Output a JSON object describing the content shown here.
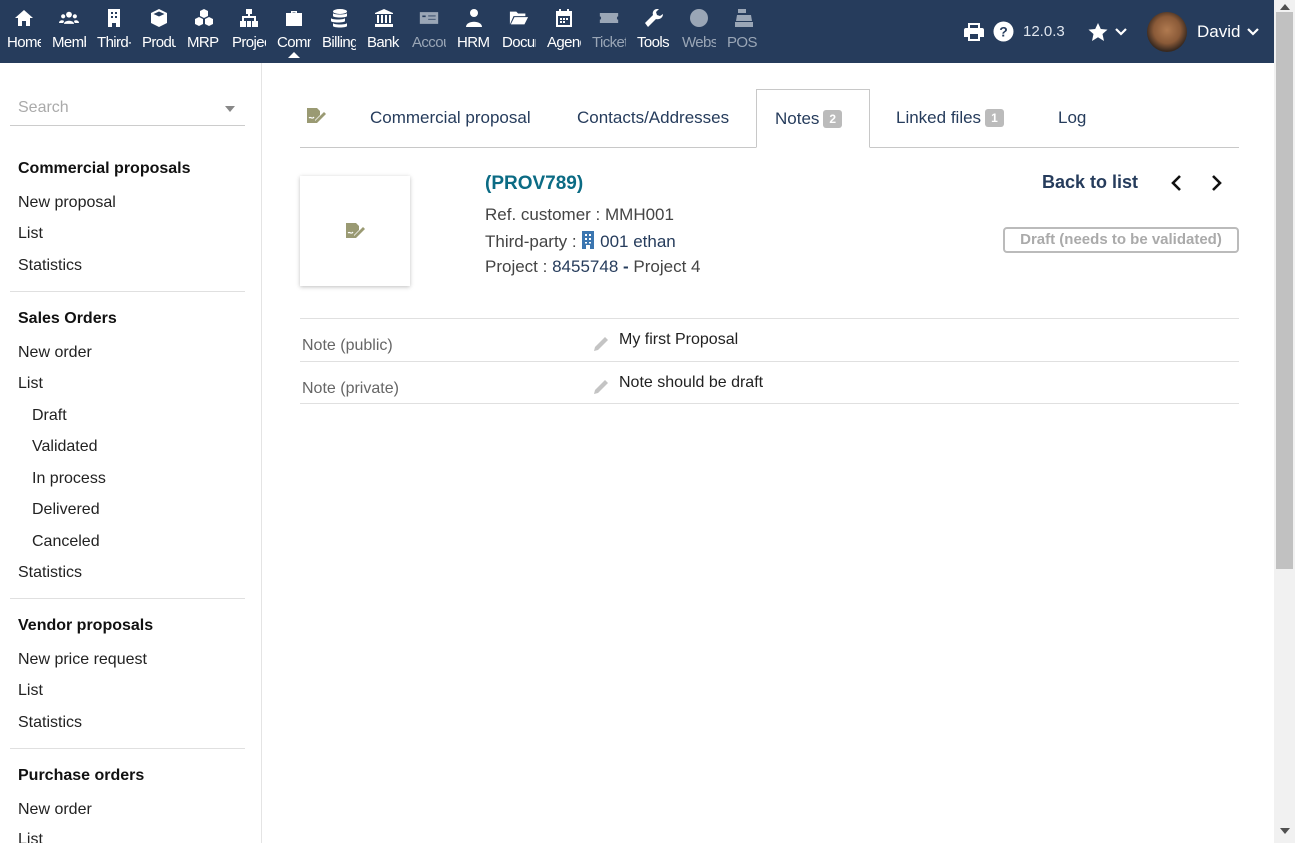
{
  "top_menu": [
    {
      "label": "Home",
      "icon": "home-icon"
    },
    {
      "label": "Members",
      "icon": "members-icon"
    },
    {
      "label": "Third-parties",
      "icon": "building-icon"
    },
    {
      "label": "Products",
      "icon": "cube-icon"
    },
    {
      "label": "MRP",
      "icon": "cubes-icon"
    },
    {
      "label": "Projects",
      "icon": "sitemap-icon"
    },
    {
      "label": "Commercial",
      "icon": "suitcase-icon"
    },
    {
      "label": "Billing",
      "icon": "coins-icon"
    },
    {
      "label": "Bank",
      "icon": "bank-icon"
    },
    {
      "label": "Accounting",
      "icon": "money-check-icon"
    },
    {
      "label": "HRM",
      "icon": "user-tie-icon"
    },
    {
      "label": "Documents",
      "icon": "folder-open-icon"
    },
    {
      "label": "Agenda",
      "icon": "calendar-icon"
    },
    {
      "label": "Tickets",
      "icon": "ticket-icon"
    },
    {
      "label": "Tools",
      "icon": "wrench-icon"
    },
    {
      "label": "Website",
      "icon": "globe-icon"
    },
    {
      "label": "POS",
      "icon": "cash-register-icon"
    }
  ],
  "top_right": {
    "version": "12.0.3",
    "user_name": "David"
  },
  "sidebar": {
    "search_placeholder": "Search",
    "sections": [
      {
        "title": "Commercial proposals",
        "items": [
          "New proposal",
          "List",
          "Statistics"
        ]
      },
      {
        "title": "Sales Orders",
        "items": [
          "New order",
          "List",
          "Draft",
          "Validated",
          "In process",
          "Delivered",
          "Canceled",
          "Statistics"
        ]
      },
      {
        "title": "Vendor proposals",
        "items": [
          "New price request",
          "List",
          "Statistics"
        ]
      },
      {
        "title": "Purchase orders",
        "items": [
          "New order",
          "List"
        ]
      }
    ]
  },
  "tabs": {
    "commercial_proposal": "Commercial proposal",
    "contacts": "Contacts/Addresses",
    "notes": "Notes",
    "notes_count": "2",
    "linked_files": "Linked files",
    "linked_files_count": "1",
    "log": "Log"
  },
  "header": {
    "ref": "(PROV789)",
    "ref_customer_label": "Ref. customer :",
    "ref_customer": "MMH001",
    "third_party_label": "Third-party :",
    "third_party": "001 ethan",
    "project_label": "Project :",
    "project_ref": "8455748",
    "project_sep": "-",
    "project_name": "Project 4",
    "back_to_list": "Back to list",
    "status": "Draft (needs to be validated)"
  },
  "notes": [
    {
      "label": "Note (public)",
      "value": "My first Proposal"
    },
    {
      "label": "Note (private)",
      "value": "Note should be draft"
    }
  ],
  "colors": {
    "topbar": "#263c5c",
    "accent_ref": "#0b6b84",
    "link": "#263c5c"
  }
}
